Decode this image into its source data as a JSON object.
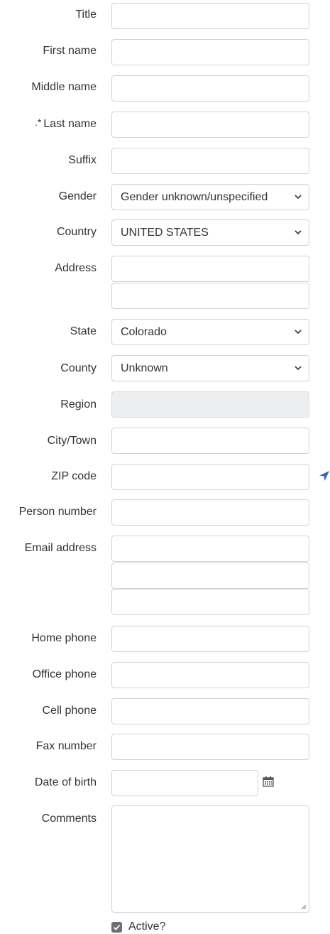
{
  "form": {
    "title_label": "Title",
    "first_name_label": "First name",
    "middle_name_label": "Middle name",
    "last_name_required_mark": ".*",
    "last_name_label": "Last name",
    "suffix_label": "Suffix",
    "gender_label": "Gender",
    "gender_value": "Gender unknown/unspecified",
    "country_label": "Country",
    "country_value": "UNITED STATES",
    "address_label": "Address",
    "state_label": "State",
    "state_value": "Colorado",
    "county_label": "County",
    "county_value": "Unknown",
    "region_label": "Region",
    "city_label": "City/Town",
    "zip_label": "ZIP code",
    "person_number_label": "Person number",
    "email_label": "Email address",
    "home_phone_label": "Home phone",
    "office_phone_label": "Office phone",
    "cell_phone_label": "Cell phone",
    "fax_label": "Fax number",
    "dob_label": "Date of birth",
    "comments_label": "Comments",
    "active_label": "Active?",
    "active_checked": true
  },
  "icons": {
    "chevron": "chevron-down-icon",
    "calendar": "calendar-icon",
    "location": "location-arrow-icon",
    "checkbox": "checkbox-checked-icon"
  },
  "colors": {
    "border": "#cfd4d9",
    "readonly_bg": "#eceeef",
    "location_icon": "#2f6db5",
    "checkbox_bg": "#6b6f74"
  }
}
